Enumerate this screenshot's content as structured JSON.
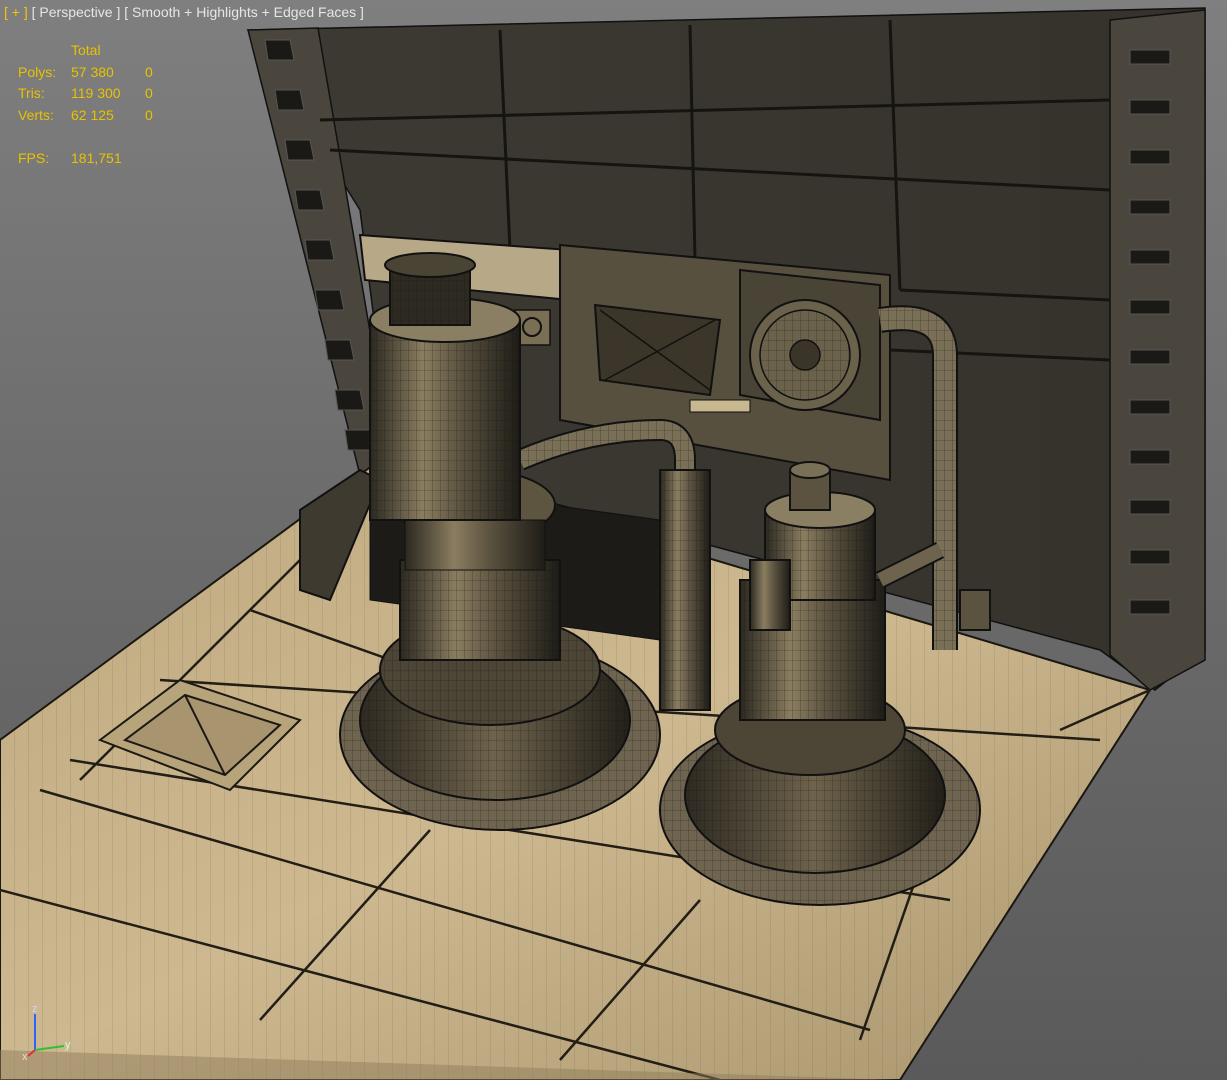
{
  "viewport": {
    "label_menu": "+",
    "label_view": "Perspective",
    "label_shading": "Smooth + Highlights + Edged Faces"
  },
  "stats": {
    "header": "Total",
    "rows": [
      {
        "label": "Polys:",
        "total": "57 380",
        "selected": "0"
      },
      {
        "label": "Tris:",
        "total": "119 300",
        "selected": "0"
      },
      {
        "label": "Verts:",
        "total": "62 125",
        "selected": "0"
      }
    ],
    "fps_label": "FPS:",
    "fps_value": "181,751"
  },
  "gizmo": {
    "x": "x",
    "y": "y",
    "z": "z"
  },
  "colors": {
    "stats_text": "#e8c200",
    "floor_tan": "#c8b48c",
    "wall_dark": "#3a3730",
    "gizmo_x": "#e03030",
    "gizmo_y": "#30c030",
    "gizmo_z": "#3060ff"
  }
}
